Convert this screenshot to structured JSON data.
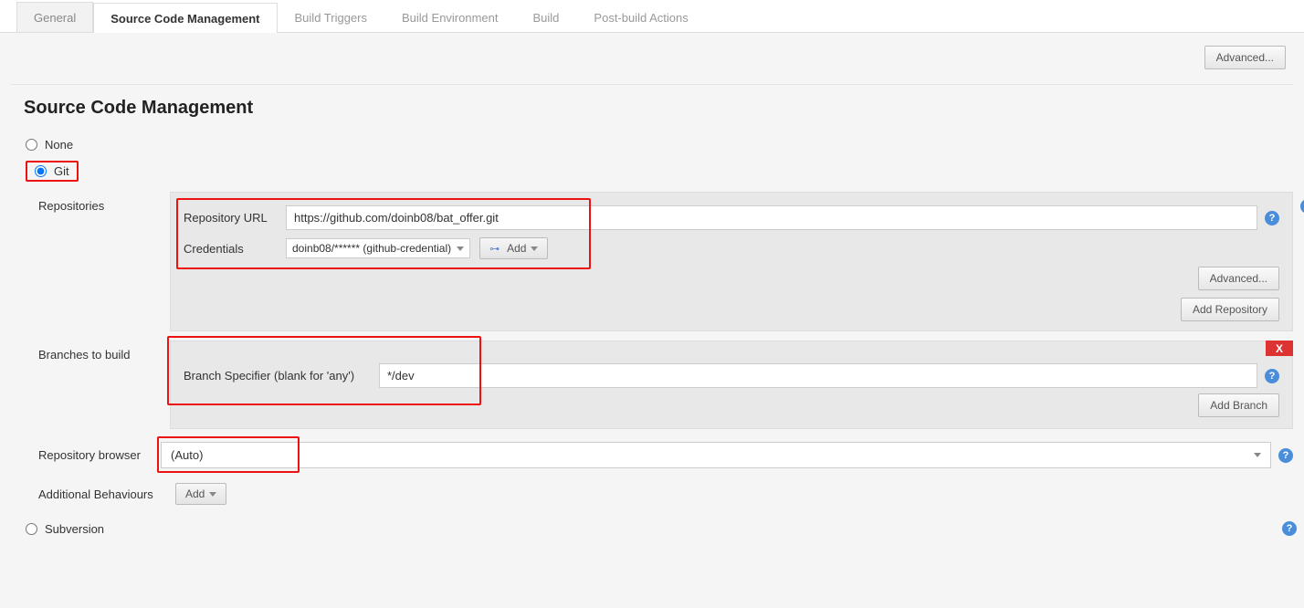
{
  "tabs": [
    {
      "label": "General",
      "active": false,
      "gray": true
    },
    {
      "label": "Source Code Management",
      "active": true
    },
    {
      "label": "Build Triggers",
      "active": false
    },
    {
      "label": "Build Environment",
      "active": false
    },
    {
      "label": "Build",
      "active": false
    },
    {
      "label": "Post-build Actions",
      "active": false
    }
  ],
  "advanced_btn": "Advanced...",
  "section_title": "Source Code Management",
  "scm_options": {
    "none": "None",
    "git": "Git",
    "subversion": "Subversion"
  },
  "repositories": {
    "label": "Repositories",
    "repo_url_label": "Repository URL",
    "repo_url_value": "https://github.com/doinb08/bat_offer.git",
    "credentials_label": "Credentials",
    "credentials_value": "doinb08/****** (github-credential)",
    "add_btn": "Add",
    "advanced_btn": "Advanced...",
    "add_repo_btn": "Add Repository"
  },
  "branches": {
    "label": "Branches to build",
    "specifier_label": "Branch Specifier (blank for 'any')",
    "specifier_value": "*/dev",
    "add_branch_btn": "Add Branch",
    "delete": "X"
  },
  "repo_browser": {
    "label": "Repository browser",
    "value": "(Auto)"
  },
  "additional_behaviours": {
    "label": "Additional Behaviours",
    "add_btn": "Add"
  },
  "help_glyph": "?"
}
